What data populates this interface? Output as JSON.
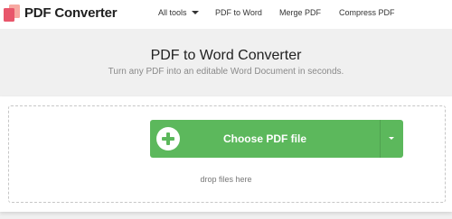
{
  "brand": {
    "name": "PDF Converter"
  },
  "nav": {
    "all_tools": "All tools",
    "pdf_to_word": "PDF to Word",
    "merge_pdf": "Merge PDF",
    "compress_pdf": "Compress PDF"
  },
  "hero": {
    "title": "PDF to Word Converter",
    "subtitle": "Turn any PDF into an editable Word Document in seconds."
  },
  "upload": {
    "button_label": "Choose PDF file",
    "drop_text": "drop files here"
  },
  "colors": {
    "accent_green": "#5cb85c",
    "logo_primary": "#e8566b",
    "logo_secondary": "#f7a8a1",
    "hero_bg": "#f0f0f0"
  },
  "icons": {
    "logo": "pdf-converter-logo",
    "nav_caret": "chevron-down-icon",
    "add": "plus-circle-icon",
    "dropdown": "caret-down-icon"
  }
}
